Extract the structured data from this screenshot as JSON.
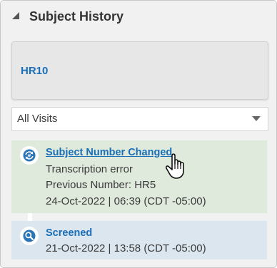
{
  "panel": {
    "title": "Subject History"
  },
  "subject": {
    "id": "HR10"
  },
  "filter": {
    "selected": "All Visits"
  },
  "events": [
    {
      "title": "Subject Number Changed",
      "details": [
        "Transcription error",
        "Previous Number: HR5",
        "24-Oct-2022 | 06:39 (CDT -05:00)"
      ],
      "icon": "number-change-icon"
    },
    {
      "title": "Screened",
      "details": [
        "21-Oct-2022 | 13:58 (CDT -05:00)"
      ],
      "icon": "screened-search-icon"
    }
  ],
  "colors": {
    "link": "#1a6fb8",
    "changed_bg": "#dfe9dc",
    "screened_bg": "#dce6ee",
    "icon_blue": "#2a74b8"
  }
}
